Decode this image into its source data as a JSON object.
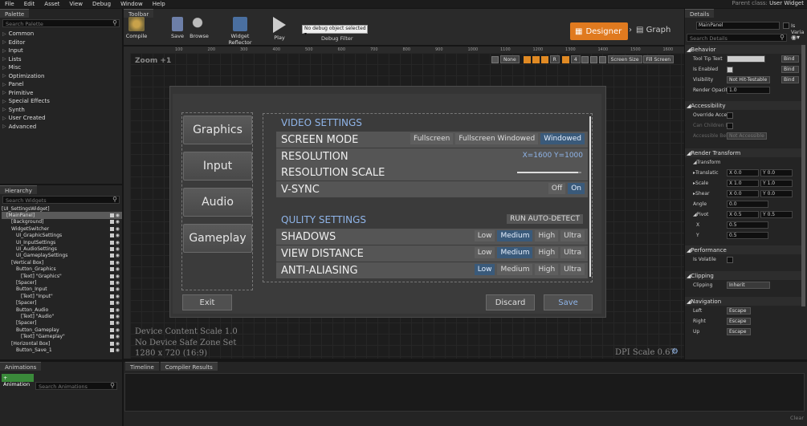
{
  "menu": [
    "File",
    "Edit",
    "Asset",
    "View",
    "Debug",
    "Window",
    "Help"
  ],
  "parent_class_label": "Parent class:",
  "parent_class_value": "User Widget",
  "palette": {
    "tab": "Palette",
    "search_placeholder": "Search Palette",
    "categories": [
      "Common",
      "Editor",
      "Input",
      "Lists",
      "Misc",
      "Optimization",
      "Panel",
      "Primitive",
      "Special Effects",
      "Synth",
      "User Created",
      "Advanced"
    ]
  },
  "hierarchy": {
    "tab": "Hierarchy",
    "search_placeholder": "Search Widgets",
    "rows": [
      {
        "label": "[UI_SettingsWidget]",
        "indent": 0
      },
      {
        "label": "[MainPanel]",
        "indent": 1
      },
      {
        "label": "[Background]",
        "indent": 2
      },
      {
        "label": "WidgetSwitcher",
        "indent": 2
      },
      {
        "label": "UI_GraphicSettings",
        "indent": 3
      },
      {
        "label": "UI_InputSettings",
        "indent": 3
      },
      {
        "label": "UI_AudioSettings",
        "indent": 3
      },
      {
        "label": "UI_GameplaySettings",
        "indent": 3
      },
      {
        "label": "[Vertical Box]",
        "indent": 2
      },
      {
        "label": "Button_Graphics",
        "indent": 3
      },
      {
        "label": "[Text] \"Graphics\"",
        "indent": 4
      },
      {
        "label": "[Spacer]",
        "indent": 3
      },
      {
        "label": "Button_Input",
        "indent": 3
      },
      {
        "label": "[Text] \"Input\"",
        "indent": 4
      },
      {
        "label": "[Spacer]",
        "indent": 3
      },
      {
        "label": "Button_Audio",
        "indent": 3
      },
      {
        "label": "[Text] \"Audio\"",
        "indent": 4
      },
      {
        "label": "[Spacer]",
        "indent": 3
      },
      {
        "label": "Button_Gameplay",
        "indent": 3
      },
      {
        "label": "[Text] \"Gameplay\"",
        "indent": 4
      },
      {
        "label": "[Horizontal Box]",
        "indent": 2
      },
      {
        "label": "Button_Save_1",
        "indent": 3
      }
    ]
  },
  "toolbar": {
    "tab": "Toolbar",
    "compile": "Compile",
    "save": "Save",
    "browse": "Browse",
    "widget_reflector": "Widget Reflector",
    "play": "Play",
    "debug_select": "No debug object selected",
    "debug_filter": "Debug Filter",
    "designer": "Designer",
    "graph": "Graph"
  },
  "ruler_ticks": [
    "100",
    "200",
    "300",
    "400",
    "500",
    "600",
    "700",
    "800",
    "900",
    "1000",
    "1100",
    "1200",
    "1300",
    "1400",
    "1500",
    "1600",
    "1700"
  ],
  "canvas": {
    "zoom": "Zoom +1",
    "none_btn": "None",
    "r_btn": "R",
    "num_btn": "4",
    "screen_size": "Screen Size",
    "fill_screen": "Fill Screen",
    "dpi_scale": "DPI Scale 0.67",
    "info_lines": [
      "Device Content Scale 1.0",
      "No Device Safe Zone Set",
      "1280 x 720 (16:9)"
    ]
  },
  "widget": {
    "menu_buttons": [
      "Graphics",
      "Input",
      "Audio",
      "Gameplay"
    ],
    "video_header": "VIDEO SETTINGS",
    "video_rows": [
      {
        "label": "SCREEN MODE",
        "options": [
          "Fullscreen",
          "Fullscreen Windowed",
          "Windowed"
        ],
        "selected": 2
      },
      {
        "label": "RESOLUTION",
        "value": "X=1600 Y=1000"
      },
      {
        "label": "RESOLUTION SCALE",
        "slider": 0.95
      },
      {
        "label": "V-SYNC",
        "options": [
          "Off",
          "On"
        ],
        "selected": 1
      }
    ],
    "quality_header": "QULITY SETTINGS",
    "auto_detect": "RUN AUTO-DETECT",
    "quality_rows": [
      {
        "label": "SHADOWS",
        "options": [
          "Low",
          "Medium",
          "High",
          "Ultra"
        ],
        "selected": 1
      },
      {
        "label": "VIEW DISTANCE",
        "options": [
          "Low",
          "Medium",
          "High",
          "Ultra"
        ],
        "selected": 1
      },
      {
        "label": "ANTI-ALIASING",
        "options": [
          "Low",
          "Medium",
          "High",
          "Ultra"
        ],
        "selected": 0
      }
    ],
    "exit": "Exit",
    "discard": "Discard",
    "save": "Save"
  },
  "details": {
    "tab": "Details",
    "name": "MainPanel",
    "is_variable": "Is Varia",
    "search_placeholder": "Search Details",
    "behavior": "Behavior",
    "tooltip": "Tool Tip Text",
    "is_enabled": "Is Enabled",
    "visibility": "Visibility",
    "visibility_value": "Not Hit-Testable",
    "render_opacity": "Render Opacity",
    "render_opacity_value": "1.0",
    "bind": "Bind",
    "accessibility": "Accessibility",
    "override_access": "Override Acces",
    "can_children": "Can Children Be",
    "accessible_beh": "Accessible Beh",
    "not_accessible": "Not Accessible",
    "render_transform": "Render Transform",
    "transform": "Transform",
    "translation": "Translatic",
    "scale": "Scale",
    "shear": "Shear",
    "angle": "Angle",
    "pivot": "Pivot",
    "x": "X",
    "y": "Y",
    "translation_x": "0.0",
    "translation_y": "0.0",
    "scale_x": "1.0",
    "scale_y": "1.0",
    "shear_x": "0.0",
    "shear_y": "0.0",
    "angle_value": "0.0",
    "pivot_x": "0.5",
    "pivot_y": "0.5",
    "pivot_sub_x": "0.5",
    "pivot_sub_y": "0.5",
    "performance": "Performance",
    "is_volatile": "Is Volatile",
    "clipping_sec": "Clipping",
    "clipping": "Clipping",
    "clipping_value": "Inherit",
    "navigation": "Navigation",
    "left": "Left",
    "right": "Right",
    "up": "Up",
    "escape": "Escape"
  },
  "bottom": {
    "animations_tab": "Animations",
    "add_animation": "+ Animation",
    "search_animations": "Search Animations",
    "timeline_tab": "Timeline",
    "compiler_tab": "Compiler Results",
    "clear": "Clear"
  }
}
